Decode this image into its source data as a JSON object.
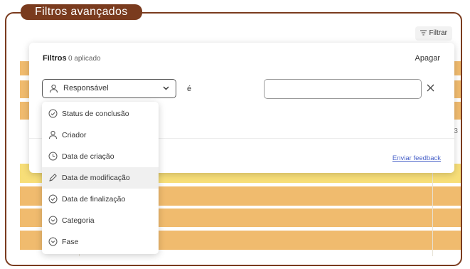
{
  "frame": {
    "title": "Filtros avançados"
  },
  "toolbar": {
    "filter_label": "Filtrar",
    "partial_text": ", 3"
  },
  "panel": {
    "title": "Filtros",
    "count": "0 aplicado",
    "clear": "Apagar",
    "field_selected": "Responsável",
    "operator": "é",
    "value": "",
    "feedback": "Enviar feedback"
  },
  "dropdown": {
    "items": [
      {
        "label": "Status de conclusão",
        "icon": "check-circle-icon"
      },
      {
        "label": "Criador",
        "icon": "person-icon"
      },
      {
        "label": "Data de criação",
        "icon": "clock-icon"
      },
      {
        "label": "Data de modificação",
        "icon": "pencil-icon"
      },
      {
        "label": "Data de finalização",
        "icon": "check-circle-icon"
      },
      {
        "label": "Categoria",
        "icon": "chevron-circle-icon"
      },
      {
        "label": "Fase",
        "icon": "chevron-circle-icon"
      }
    ],
    "highlighted_index": 3
  },
  "colors": {
    "frame_brown": "#7a3b1e",
    "row_orange": "#f0bb6e",
    "row_yellow": "#f7de78",
    "link_blue": "#4a63c9"
  }
}
